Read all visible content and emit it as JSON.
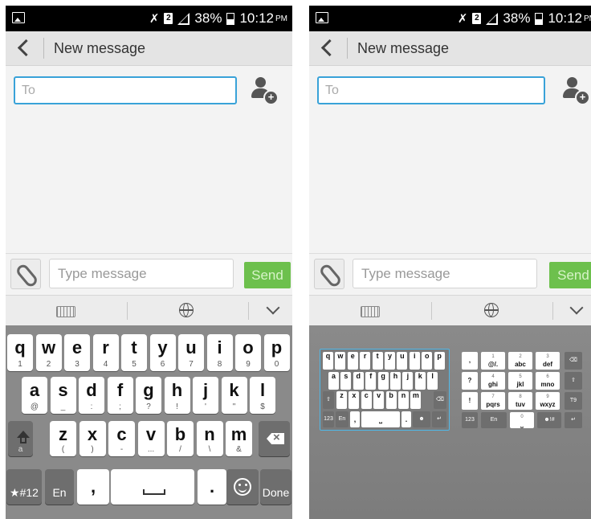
{
  "status_bar": {
    "battery": "38%",
    "time": "10:12",
    "ampm": "PM"
  },
  "title_bar": {
    "title": "New message"
  },
  "recipient": {
    "placeholder": "To"
  },
  "compose": {
    "placeholder": "Type message",
    "send_label": "Send"
  },
  "keyboard": {
    "row1": [
      {
        "m": "q",
        "s": "1"
      },
      {
        "m": "w",
        "s": "2"
      },
      {
        "m": "e",
        "s": "3"
      },
      {
        "m": "r",
        "s": "4"
      },
      {
        "m": "t",
        "s": "5"
      },
      {
        "m": "y",
        "s": "6"
      },
      {
        "m": "u",
        "s": "7"
      },
      {
        "m": "i",
        "s": "8"
      },
      {
        "m": "o",
        "s": "9"
      },
      {
        "m": "p",
        "s": "0"
      }
    ],
    "row2": [
      {
        "m": "a",
        "s": "@"
      },
      {
        "m": "s",
        "s": "_"
      },
      {
        "m": "d",
        "s": ":"
      },
      {
        "m": "f",
        "s": ";"
      },
      {
        "m": "g",
        "s": "?"
      },
      {
        "m": "h",
        "s": "!"
      },
      {
        "m": "j",
        "s": "'"
      },
      {
        "m": "k",
        "s": "\""
      },
      {
        "m": "l",
        "s": "$"
      }
    ],
    "row3": [
      {
        "m": "z",
        "s": "("
      },
      {
        "m": "x",
        "s": ")"
      },
      {
        "m": "c",
        "s": "-"
      },
      {
        "m": "v",
        "s": "..."
      },
      {
        "m": "b",
        "s": "/"
      },
      {
        "m": "n",
        "s": "\\"
      },
      {
        "m": "m",
        "s": "&"
      }
    ],
    "shift_sub": "a",
    "bottom": {
      "symbols": "★#12",
      "lang": "En",
      "comma": ",",
      "period": ".",
      "done": "Done"
    }
  },
  "mini_keyboard": {
    "row1": [
      "q",
      "w",
      "e",
      "r",
      "t",
      "y",
      "u",
      "i",
      "o",
      "p"
    ],
    "row2": [
      "a",
      "s",
      "d",
      "f",
      "g",
      "h",
      "j",
      "k",
      "l"
    ],
    "row3": [
      "z",
      "x",
      "c",
      "v",
      "b",
      "n",
      "m"
    ],
    "bottom": {
      "num": "123",
      "lang": "En"
    }
  },
  "phone_pad": {
    "keys": [
      {
        "n": "1",
        "l": "@/."
      },
      {
        "n": "2",
        "l": "abc"
      },
      {
        "n": "3",
        "l": "def"
      },
      {
        "n": "4",
        "l": "ghi"
      },
      {
        "n": "5",
        "l": "jkl"
      },
      {
        "n": "6",
        "l": "mno"
      },
      {
        "n": "7",
        "l": "pqrs"
      },
      {
        "n": "8",
        "l": "tuv"
      },
      {
        "n": "9",
        "l": "wxyz"
      }
    ],
    "side_top": [
      ",",
      "?",
      "!"
    ],
    "right_label": "T9",
    "num": "123",
    "lang": "En",
    "zero": "0",
    "symbols": "☻!#"
  }
}
